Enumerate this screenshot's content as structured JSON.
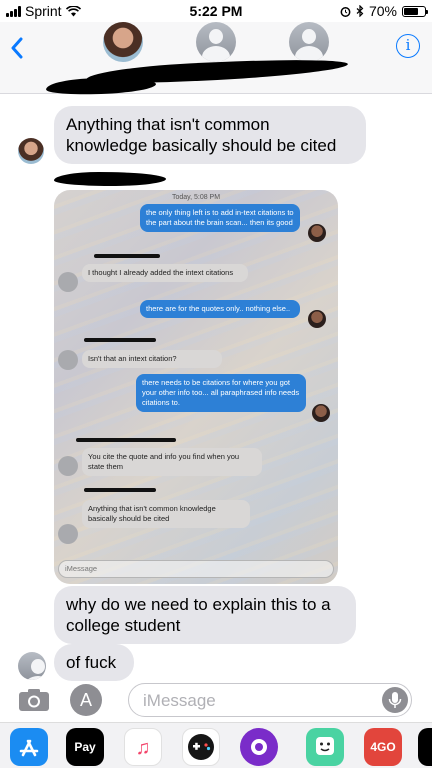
{
  "status_bar": {
    "carrier": "Sprint",
    "time": "5:22 PM",
    "battery": "70%",
    "battery_level": 0.7,
    "icons": [
      "signal-icon",
      "wifi-icon",
      "alarm-icon",
      "bluetooth-icon",
      "battery-icon"
    ]
  },
  "header": {
    "back_icon": "chevron-left-icon",
    "info_label": "i",
    "accent": "#0a7aff"
  },
  "messages": [
    {
      "text": "Anything that isn't common knowledge basically should be cited"
    },
    {
      "text": "why do we need to explain this to a college student"
    },
    {
      "text": "of fuck"
    }
  ],
  "photo": {
    "timestamp": "Today, 5:08 PM",
    "messages": [
      {
        "dir": "out",
        "text": "the only thing left is to add in-text citations to the part about the brain scan... then its good"
      },
      {
        "dir": "in",
        "text": "I thought I already added the intext citations"
      },
      {
        "dir": "out",
        "text": "there are for the quotes only.. nothing else.."
      },
      {
        "dir": "in",
        "text": "Isn't that an intext citation?"
      },
      {
        "dir": "out",
        "text": "there needs to be citations for where you got your other info too... all paraphrased info needs citations to."
      },
      {
        "dir": "in",
        "text": "You cite the quote and info you find when you state them"
      },
      {
        "dir": "in",
        "text": "Anything that isn't common knowledge basically should be cited"
      }
    ],
    "input_placeholder": "iMessage"
  },
  "input": {
    "placeholder": "iMessage",
    "app_store_label": "A"
  },
  "tray": {
    "apple_pay_label": "Pay",
    "app_4go_label": "4GO",
    "apps": [
      "app-store-icon",
      "apple-pay-icon",
      "music-icon",
      "game-icon",
      "camera-app-icon",
      "bitmoji-icon",
      "4go-icon"
    ]
  },
  "colors": {
    "incoming_bubble": "#e5e5ea",
    "outgoing_bubble_photo": "#2d80d6",
    "ios_blue": "#0a7aff"
  }
}
